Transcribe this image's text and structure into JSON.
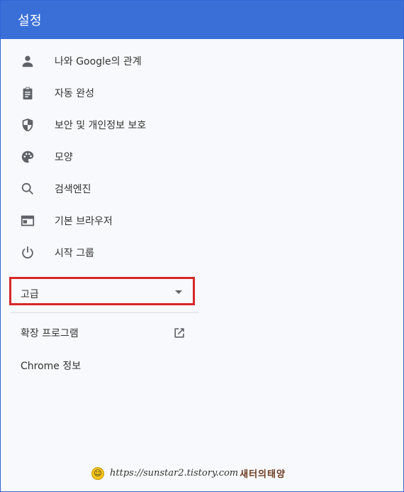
{
  "header": {
    "title": "설정"
  },
  "menu": {
    "items": [
      {
        "label": "나와 Google의 관계",
        "icon": "person-icon"
      },
      {
        "label": "자동 완성",
        "icon": "clipboard-icon"
      },
      {
        "label": "보안 및 개인정보 보호",
        "icon": "shield-icon"
      },
      {
        "label": "모양",
        "icon": "palette-icon"
      },
      {
        "label": "검색엔진",
        "icon": "search-icon"
      },
      {
        "label": "기본 브라우저",
        "icon": "browser-window-icon"
      },
      {
        "label": "시작 그룹",
        "icon": "power-icon"
      }
    ]
  },
  "advanced": {
    "label": "고급",
    "icon": "caret-down-icon",
    "highlight_color": "#d62828"
  },
  "lower": {
    "extensions_label": "확장 프로그램",
    "extensions_icon": "open-in-new-icon",
    "about_label": "Chrome 정보"
  },
  "watermark": {
    "url": "https://sunstar2.tistory.com",
    "brand": "새터의태양"
  },
  "colors": {
    "header_bg": "#3a6fd8",
    "page_bg": "#f8f9fc",
    "icon": "#5f6368"
  }
}
